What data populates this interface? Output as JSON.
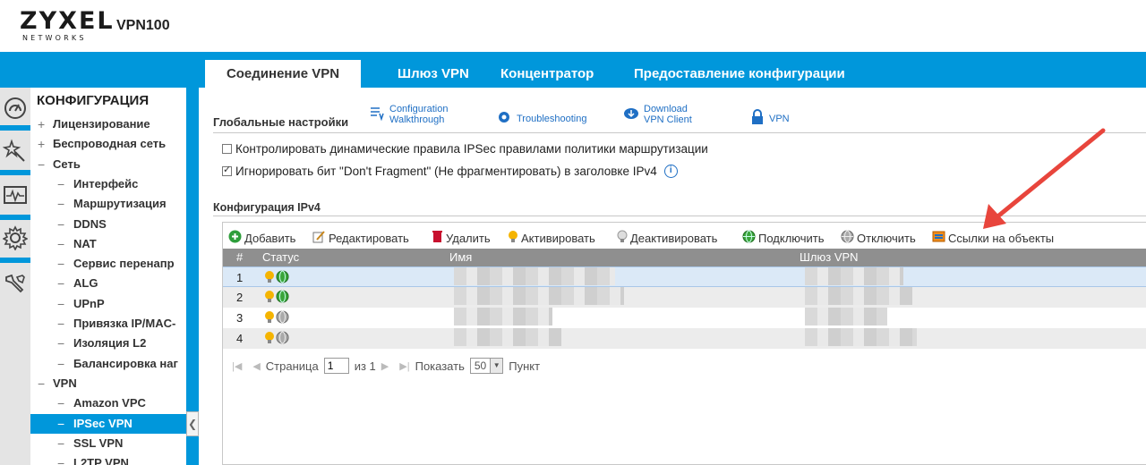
{
  "header": {
    "brand": "ZYXEL",
    "brand_sub": "NETWORKS",
    "model": "VPN100"
  },
  "tabs": [
    {
      "label": "Соединение VPN",
      "active": true
    },
    {
      "label": "Шлюз VPN",
      "active": false
    },
    {
      "label": "Концентратор",
      "active": false
    },
    {
      "label": "Предоставление конфигурации",
      "active": false
    }
  ],
  "rail": {
    "icons": [
      "dashboard-icon",
      "wizard-icon",
      "monitor-icon",
      "configuration-gear-icon",
      "maintenance-tools-icon"
    ]
  },
  "nav": {
    "title": "КОНФИГУРАЦИЯ",
    "items": [
      {
        "mark": "+",
        "label": "Лицензирование",
        "level": 0
      },
      {
        "mark": "+",
        "label": "Беспроводная сеть",
        "level": 0
      },
      {
        "mark": "−",
        "label": "Сеть",
        "level": 0
      },
      {
        "mark": "−",
        "label": "Интерфейс",
        "level": 1
      },
      {
        "mark": "−",
        "label": "Маршрутизация",
        "level": 1
      },
      {
        "mark": "−",
        "label": "DDNS",
        "level": 1
      },
      {
        "mark": "−",
        "label": "NAT",
        "level": 1
      },
      {
        "mark": "−",
        "label": "Сервис перенапр",
        "level": 1
      },
      {
        "mark": "−",
        "label": "ALG",
        "level": 1
      },
      {
        "mark": "−",
        "label": "UPnP",
        "level": 1
      },
      {
        "mark": "−",
        "label": "Привязка IP/MAC-",
        "level": 1
      },
      {
        "mark": "−",
        "label": "Изоляция L2",
        "level": 1
      },
      {
        "mark": "−",
        "label": "Балансировка наг",
        "level": 1
      },
      {
        "mark": "−",
        "label": "VPN",
        "level": 0
      },
      {
        "mark": "−",
        "label": "Amazon VPC",
        "level": 1
      },
      {
        "mark": "−",
        "label": "IPSec VPN",
        "level": 1,
        "selected": true
      },
      {
        "mark": "−",
        "label": "SSL VPN",
        "level": 1
      },
      {
        "mark": "−",
        "label": "L2TP VPN",
        "level": 1
      }
    ],
    "collapse_glyph": "❮"
  },
  "main": {
    "global_title": "Глобальные настройки",
    "links": {
      "walkthrough_1": "Configuration",
      "walkthrough_2": "Walkthrough",
      "troubleshooting": "Troubleshooting",
      "download_1": "Download",
      "download_2": "VPN Client",
      "vpn": "VPN"
    },
    "checkbox_1": {
      "label": "Контролировать динамические правила IPSec правилами политики маршрутизации",
      "checked": false
    },
    "checkbox_2": {
      "label": "Игнорировать бит \"Don't Fragment\" (Не фрагментировать) в заголовке IPv4",
      "checked": true
    },
    "ipv4_title": "Конфигурация IPv4",
    "toolbar": {
      "add": "Добавить",
      "edit": "Редактировать",
      "delete": "Удалить",
      "activate": "Активировать",
      "deactivate": "Деактивировать",
      "connect": "Подключить",
      "disconnect": "Отключить",
      "references": "Ссылки на объекты"
    },
    "columns": {
      "num": "#",
      "status": "Статус",
      "name": "Имя",
      "gateway": "Шлюз VPN"
    },
    "rows": [
      {
        "num": "1",
        "connected": true
      },
      {
        "num": "2",
        "connected": true
      },
      {
        "num": "3",
        "connected": false
      },
      {
        "num": "4",
        "connected": false
      }
    ],
    "pager": {
      "page_label": "Страница",
      "page_value": "1",
      "of_label": "из 1",
      "show_label": "Показать",
      "show_value": "50",
      "items_label": "Пункт"
    }
  },
  "colors": {
    "accent": "#0097db",
    "link": "#1f6fc4",
    "annotation_arrow": "#e8453c"
  }
}
